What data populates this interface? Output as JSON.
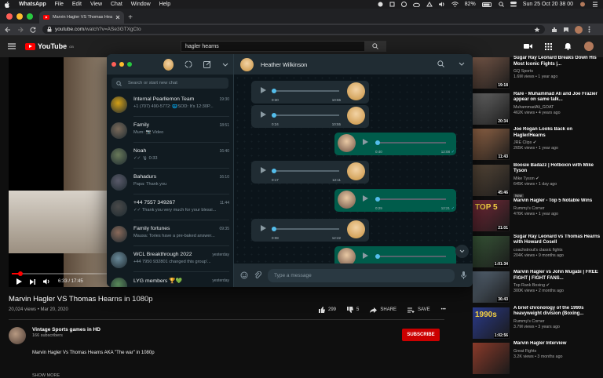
{
  "menubar": {
    "apple": "",
    "app": "WhatsApp",
    "items": [
      "File",
      "Edit",
      "View",
      "Chat",
      "Window",
      "Help"
    ],
    "battery": "82%",
    "datetime": "Sun 25 Oct  20 38 00"
  },
  "browser": {
    "tab_title": "Marvin Hagler VS Thomas Hea",
    "url_prefix": "youtube.com",
    "url_rest": "/watch?v=ASe3GTXgCto"
  },
  "youtube": {
    "logo_text": "YouTube",
    "country": "GB",
    "search_value": "hagler hearns"
  },
  "video": {
    "progress": 0.02,
    "time": "6:33 / 17:45",
    "title": "Marvin Hagler VS Thomas Hearns in 1080p",
    "meta": "20,024 views • Mar 20, 2020",
    "likes": "299",
    "dislikes": "5",
    "share": "SHARE",
    "save": "SAVE",
    "more": "•••",
    "channel": "Vintage Sports games in HD",
    "subscribers": "166 subscribers",
    "subscribe": "SUBSCRIBE",
    "description": "Marvin Hagler Vs Thomas Hearns AKA \"The war\" in 1080p",
    "show_more": "SHOW MORE"
  },
  "recs": [
    {
      "title": "Sugar Ray Leonard Breaks Down His Most Iconic Fights |...",
      "channel": "GQ Sports",
      "views": "1.6M views • 1 year ago",
      "dur": "19:18",
      "thumb": "#7a5a4a"
    },
    {
      "title": "Rare - Muhammad Ali and Joe Frazier appear on same talk...",
      "channel": "MuhammadAli_GOAT",
      "views": "462K views • 4 years ago",
      "dur": "20:34",
      "thumb": "#6b6b6b"
    },
    {
      "title": "Joe Rogan Looks Back on Hagler/Hearns",
      "channel": "JRE Clips ✔",
      "views": "265K views • 1 year ago",
      "dur": "11:43",
      "thumb": "#9a6a4a"
    },
    {
      "title": "Boosie Badazz | Hotboxin with Mike Tyson",
      "channel": "Mike Tyson ✔",
      "views": "645K views • 1 day ago",
      "badge": "New",
      "dur": "45:46",
      "thumb": "#5a4a3a"
    },
    {
      "title": "Marvin Hagler - Top 5 Notable Wins",
      "channel": "Rummy's Corner",
      "views": "476K views • 1 year ago",
      "dur": "21:01",
      "thumb": "#7a2a3a",
      "thumb_text": "TOP 5"
    },
    {
      "title": "Sugar Ray Leonard vs Thomas Hearns with Howard Cosell",
      "channel": "coachstrout's classic fights",
      "views": "204K views • 9 months ago",
      "dur": "1:01:34",
      "thumb": "#3a5a3a"
    },
    {
      "title": "Marvin Hagler vs John Mugabi | FREE FIGHT | FIGHT FANS...",
      "channel": "Top Rank Boxing ✔",
      "views": "300K views • 2 months ago",
      "dur": "36:43",
      "thumb": "#5a6a7a"
    },
    {
      "title": "A brief chronology of the 1990s heavyweight division (Boxing...",
      "channel": "Rummy's Corner",
      "views": "3.7M views • 3 years ago",
      "dur": "1:02:56",
      "thumb": "#2a3a8a",
      "thumb_text": "1990s"
    },
    {
      "title": "Marvin Hagler Interview",
      "channel": "Great Fights",
      "views": "3.2K views • 3 months ago",
      "dur": "",
      "thumb": "#8a3a2a"
    }
  ],
  "whatsapp": {
    "search_placeholder": "Search or start new chat",
    "chats": [
      {
        "name": "Internal Pearllemon Team",
        "time": "19:30",
        "preview": "+1 (707) 490-5772: 🌐SOD: It's 12:30P...",
        "av": "#d4a017"
      },
      {
        "name": "Family",
        "time": "18:51",
        "preview": "Mum: 📷 Video",
        "av": "#7a6a5a"
      },
      {
        "name": "Noah",
        "time": "16:40",
        "preview": "✓✓ 🎙 0:33",
        "av": "#6a7a5a"
      },
      {
        "name": "Bahadurs",
        "time": "16:10",
        "preview": "Papa: Thank you",
        "av": "#5a5a6a"
      },
      {
        "name": "+44 7557 349267",
        "time": "11:44",
        "preview": "✓✓ Thank you very much for your blessi...",
        "av": "#4a4a4a"
      },
      {
        "name": "Family fortunes",
        "time": "09:35",
        "preview": "Mausa: Tories have a pre-baked answer...",
        "av": "#8a6a5a"
      },
      {
        "name": "WCL Breakthrough 2022",
        "time": "yesterday",
        "preview": "+44 7950 932801 changed this group'...",
        "av": "#6a8a9a"
      },
      {
        "name": "LYG members 🏆💚",
        "time": "yesterday",
        "preview": "",
        "av": "#5a8a5a"
      }
    ],
    "contact": "Heather Wilkinson",
    "messages": [
      {
        "dir": "in",
        "dur": "0:30",
        "time": "10:55"
      },
      {
        "dir": "in",
        "dur": "0:24",
        "time": "10:55"
      },
      {
        "dir": "out",
        "dur": "0:40",
        "time": "12:08"
      },
      {
        "dir": "in",
        "dur": "0:17",
        "time": "12:11"
      },
      {
        "dir": "out",
        "dur": "0:29",
        "time": "12:21"
      },
      {
        "dir": "in",
        "dur": "0:08",
        "time": "12:22"
      },
      {
        "dir": "out",
        "dur": "",
        "time": ""
      }
    ],
    "composer_placeholder": "Type a message"
  }
}
